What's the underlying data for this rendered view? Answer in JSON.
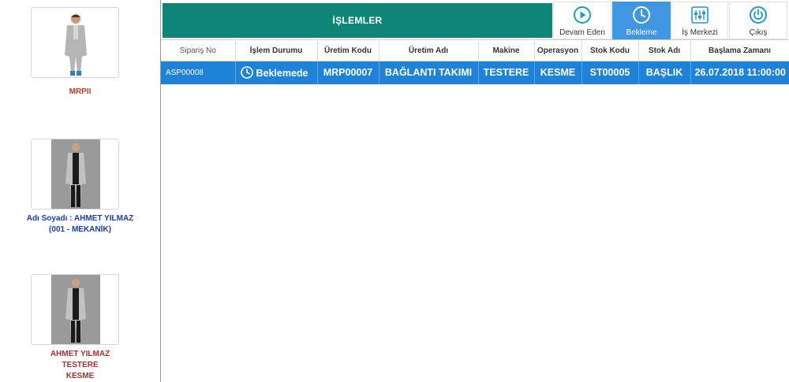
{
  "sidebar": {
    "cards": [
      {
        "caption_lines": [
          "MRPII"
        ]
      },
      {
        "caption_lines": [
          "Adı Soyadı : AHMET YILMAZ",
          "(001 - MEKANİK)"
        ]
      },
      {
        "caption_lines": [
          "AHMET YILMAZ",
          "TESTERE",
          "KESME"
        ]
      }
    ],
    "arrow": "›"
  },
  "header": {
    "title": "İŞLEMLER",
    "buttons": {
      "devam": "Devam Eden",
      "bekleme": "Bekleme",
      "ismerkezi": "İş Merkezi",
      "cikis": "Çıkış"
    }
  },
  "table": {
    "columns": [
      "Sipariş No",
      "İşlem Durumu",
      "Üretim Kodu",
      "Üretim Adı",
      "Makine",
      "Operasyon",
      "Stok Kodu",
      "Stok Adı",
      "Başlama Zamanı"
    ],
    "rows": [
      [
        "ASP00008",
        "Beklemede",
        "MRP00007",
        "BAĞLANTI TAKIMI",
        "TESTERE",
        "KESME",
        "ST00005",
        "BAŞLIK",
        "26.07.2018 11:00:00"
      ]
    ]
  },
  "colors": {
    "title_bg": "#0e8577",
    "active_button": "#3e97e0",
    "selected_row": "#1e82d8",
    "icon_teal": "#1a9bd0"
  }
}
